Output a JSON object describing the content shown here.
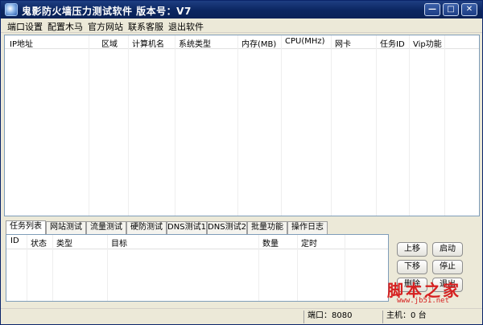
{
  "window": {
    "title": "鬼影防火墙压力测试软件  版本号：V7",
    "controls": {
      "minimize": "—",
      "maximize": "□",
      "close": "✕"
    }
  },
  "menu": [
    "端口设置",
    "配置木马",
    "官方网站",
    "联系客服",
    "退出软件"
  ],
  "main_table": {
    "columns": [
      "IP地址",
      "区域",
      "计算机名",
      "系统类型",
      "内存(MB)",
      "CPU(MHz)",
      "网卡",
      "任务ID",
      "Vip功能"
    ],
    "rows": []
  },
  "tabs": [
    "任务列表",
    "网站测试",
    "流量测试",
    "硬防测试",
    "DNS测试1",
    "DNS测试2",
    "批量功能",
    "操作日志"
  ],
  "active_tab": "任务列表",
  "task_table": {
    "columns": [
      "ID",
      "状态",
      "类型",
      "目标",
      "数量",
      "定时"
    ],
    "rows": []
  },
  "side_buttons": [
    "上移",
    "启动",
    "下移",
    "停止",
    "删除",
    "退出"
  ],
  "status": {
    "port_label": "端口：",
    "port_value": "8080",
    "host_label": "主机：",
    "host_value": "0",
    "host_unit": "台"
  },
  "watermark": {
    "text": "脚本之家",
    "url": "www.jb51.net"
  },
  "colors": {
    "title_bar": "#0b2660",
    "watermark": "#d62020",
    "list_border": "#7f9db9"
  },
  "icons": {
    "app": "shield-app-icon"
  }
}
